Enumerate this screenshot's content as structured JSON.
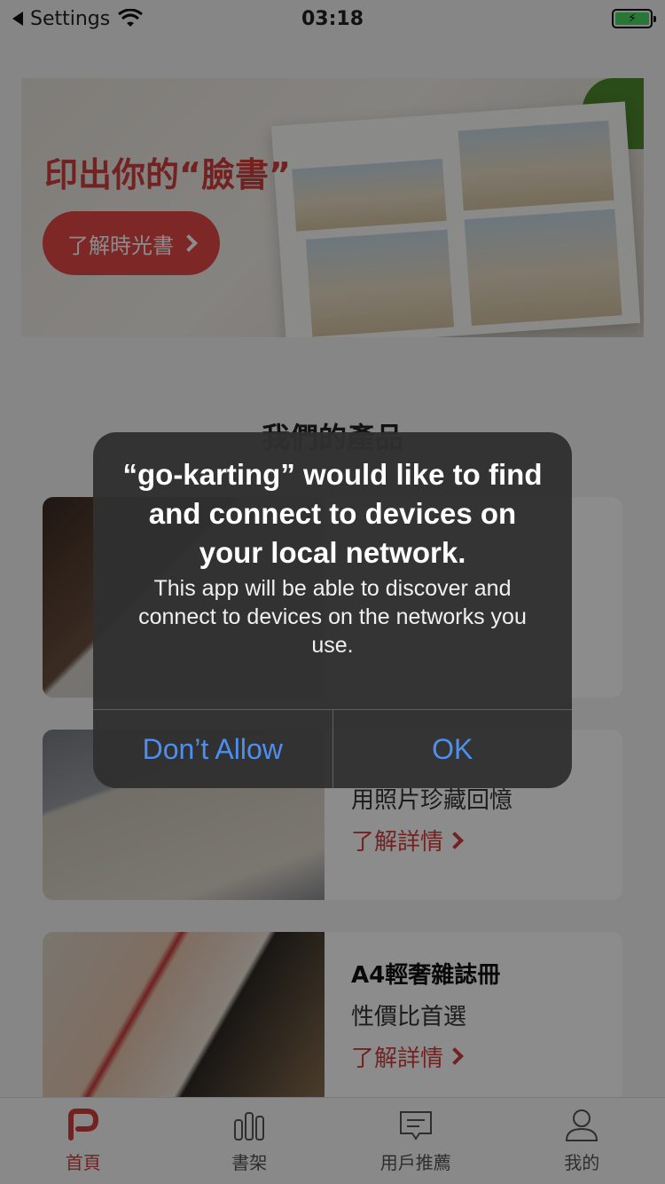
{
  "status_bar": {
    "back_label": "Settings",
    "time": "03:18",
    "battery_glyph": "⚡"
  },
  "banner": {
    "title": "印出你的“臉書”",
    "button_label": "了解時光書"
  },
  "section": {
    "title": "我們的產品"
  },
  "products": [
    {
      "name": "",
      "desc": "",
      "more": ""
    },
    {
      "name": "",
      "desc": "用照片珍藏回憶",
      "more": "了解詳情"
    },
    {
      "name": "A4輕奢雜誌冊",
      "desc": "性價比首選",
      "more": "了解詳情"
    }
  ],
  "tabbar": {
    "items": [
      {
        "label": "首頁",
        "icon": "home-logo-icon",
        "active": true
      },
      {
        "label": "書架",
        "icon": "bookshelf-icon",
        "active": false
      },
      {
        "label": "用戶推薦",
        "icon": "message-icon",
        "active": false
      },
      {
        "label": "我的",
        "icon": "user-icon",
        "active": false
      }
    ]
  },
  "alert": {
    "title": "“go-karting” would like to find and connect to devices on your local network.",
    "message": "This app will be able to discover and connect to devices on the networks you use.",
    "deny_label": "Don’t Allow",
    "ok_label": "OK"
  },
  "colors": {
    "brand": "#d13e3e",
    "alert_button": "#4d8ff0"
  }
}
